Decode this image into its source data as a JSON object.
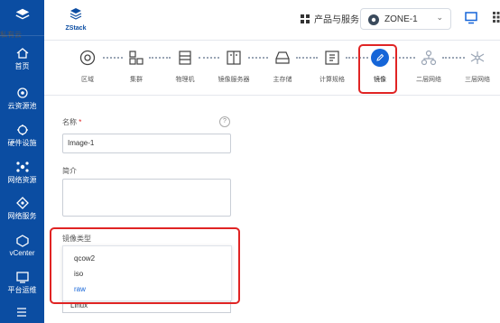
{
  "sidebar": {
    "brand": "私有云",
    "items": [
      {
        "label": "首页",
        "icon": "home-icon"
      },
      {
        "label": "云资源池",
        "icon": "cloud-pool-icon"
      },
      {
        "label": "硬件设施",
        "icon": "hardware-icon"
      },
      {
        "label": "网络资源",
        "icon": "network-icon"
      },
      {
        "label": "网络服务",
        "icon": "network-service-icon"
      },
      {
        "label": "vCenter",
        "icon": "vcenter-icon"
      },
      {
        "label": "平台运维",
        "icon": "ops-icon"
      }
    ]
  },
  "topbar": {
    "logo_text": "ZStack",
    "products": "产品与服务",
    "zone": "ZONE-1"
  },
  "steps": [
    {
      "label": "区域"
    },
    {
      "label": "集群"
    },
    {
      "label": "物理机"
    },
    {
      "label": "镜像服务器"
    },
    {
      "label": "主存储"
    },
    {
      "label": "计算规格"
    },
    {
      "label": "镜像"
    },
    {
      "label": "二层网络"
    },
    {
      "label": "三层网络"
    }
  ],
  "form": {
    "name_label": "名称",
    "name_value": "Image-1",
    "desc_label": "简介",
    "type_label": "镜像类型",
    "type_options": [
      "qcow2",
      "iso",
      "raw"
    ],
    "selected_option": "raw",
    "below_value": "Linux"
  },
  "colors": {
    "sidebar": "#0b4da2",
    "accent": "#1565d8",
    "highlight": "#e02424"
  }
}
